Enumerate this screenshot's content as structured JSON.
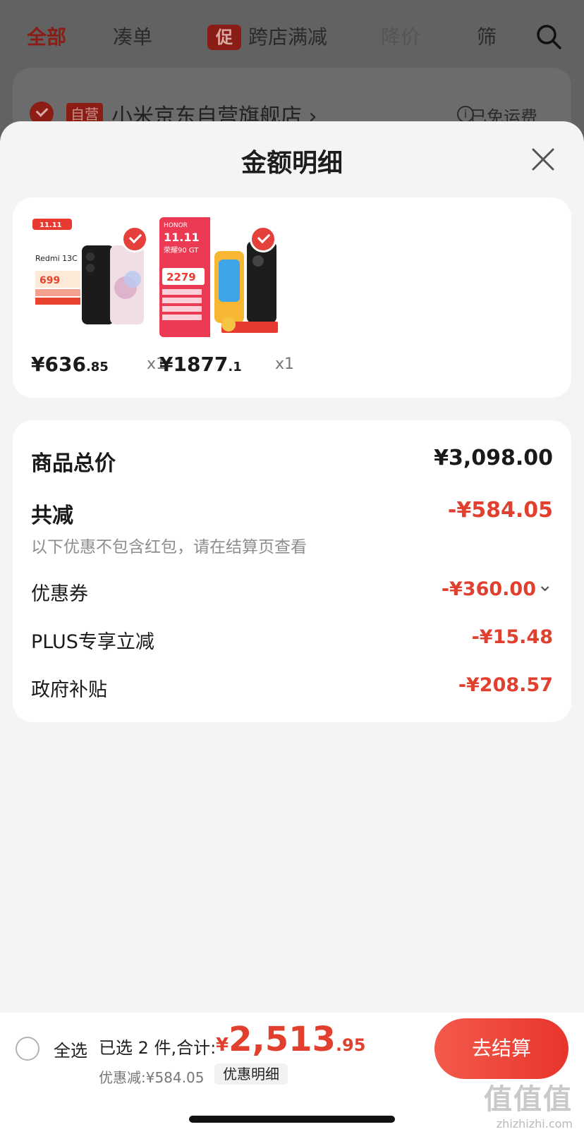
{
  "background": {
    "tabs": [
      {
        "label": "全部",
        "active": true
      },
      {
        "label": "凑单",
        "active": false
      },
      {
        "label": "跨店满减",
        "active": false,
        "chip": "促"
      },
      {
        "label": "降价",
        "active": false
      },
      {
        "label": "筛",
        "active": false
      }
    ],
    "store": {
      "badge": "自营",
      "name": "小米京东自营旗舰店 ›",
      "shipping": "已免运费"
    }
  },
  "sheet": {
    "title": "金额明细",
    "items": [
      {
        "price_int": "¥636",
        "price_dec": ".85",
        "qty": "x1",
        "brand": "Redmi 13C",
        "promo_price": "699",
        "logo": "11.11"
      },
      {
        "price_int": "¥1877",
        "price_dec": ".1",
        "qty": "x1",
        "brand": "HONOR",
        "promo_price": "2279",
        "model": "荣耀90 GT",
        "logo": "11.11"
      }
    ],
    "details": {
      "total_label": "商品总价",
      "total_value": "¥3,098.00",
      "discount_label": "共减",
      "discount_value": "-¥584.05",
      "note": "以下优惠不包含红包，请在结算页查看",
      "lines": [
        {
          "label": "优惠券",
          "value": "-¥360.00",
          "chevron": "⌄"
        },
        {
          "label": "PLUS专享立减",
          "value": "-¥15.48"
        },
        {
          "label": "政府补贴",
          "value": "-¥208.57"
        }
      ]
    }
  },
  "bottom": {
    "select_all": "全选",
    "summary": "已选 2 件,合计:",
    "currency": "¥",
    "total_int": "2,513",
    "total_dec": ".95",
    "saving": "优惠减:¥584.05",
    "detail_link": "优惠明细",
    "checkout": "去结算"
  },
  "watermark": {
    "main": "值值值",
    "sub": "zhizhizhi.com"
  },
  "colors": {
    "accent": "#e2402f",
    "sheet_bg": "#f4f4f4",
    "overlay": "#626262"
  }
}
